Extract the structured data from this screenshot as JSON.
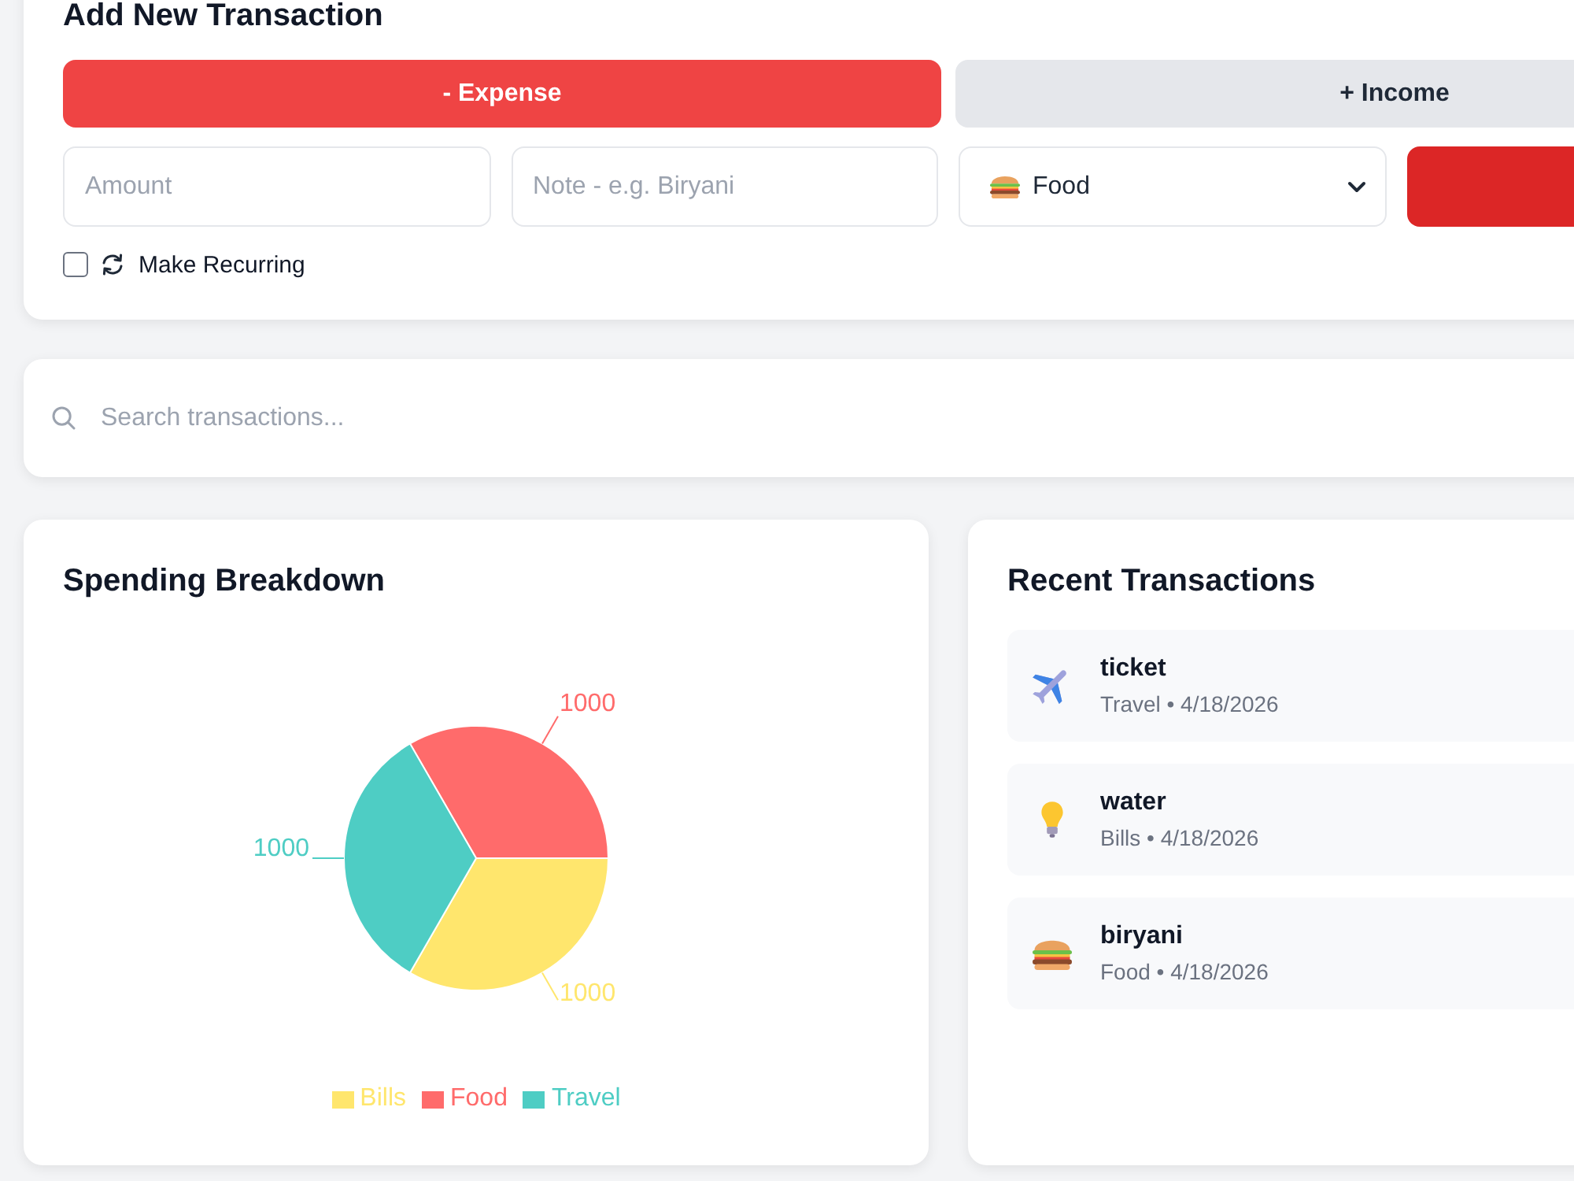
{
  "form": {
    "title": "Add New Transaction",
    "type_tabs": [
      {
        "label": "- Expense",
        "selected": true
      },
      {
        "label": "+ Income",
        "selected": false
      }
    ],
    "amount": {
      "placeholder": "Amount"
    },
    "note": {
      "placeholder": "Note - e.g. Biryani"
    },
    "category": {
      "value": "Food",
      "kind": "food"
    },
    "recurring": {
      "label": "Make Recurring",
      "checked": false
    }
  },
  "search": {
    "placeholder": "Search transactions..."
  },
  "spending": {
    "title": "Spending Breakdown",
    "chart_data": {
      "type": "pie",
      "categories": [
        "Bills",
        "Food",
        "Travel"
      ],
      "values": [
        1000,
        1000,
        1000
      ],
      "data_labels": true,
      "legend": "bottom"
    },
    "slices": [
      {
        "color": "#ffe66d"
      },
      {
        "color": "#ff6b6b"
      },
      {
        "color": "#4ecdc4"
      }
    ]
  },
  "recent": {
    "title": "Recent Transactions",
    "transactions": [
      {
        "name": "ticket",
        "meta": "Travel • 4/18/2026",
        "kind": "travel"
      },
      {
        "name": "water",
        "meta": "Bills • 4/18/2026",
        "kind": "bills"
      },
      {
        "name": "biryani",
        "meta": "Food • 4/18/2026",
        "kind": "food"
      }
    ]
  }
}
